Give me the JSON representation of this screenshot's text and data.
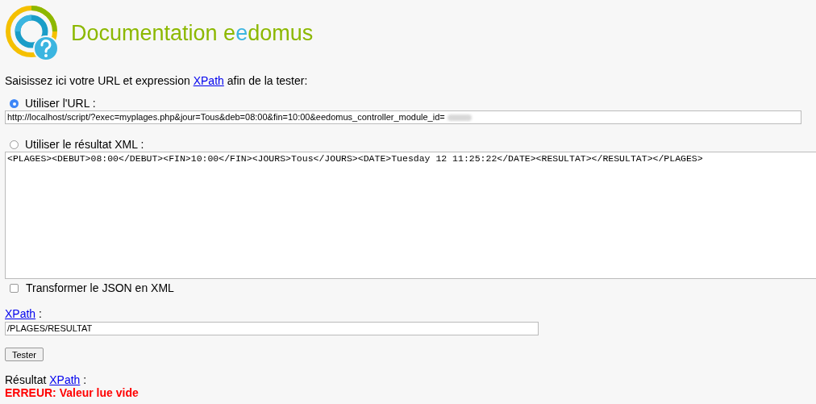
{
  "header": {
    "title": [
      {
        "text": "Documentation ",
        "color": "#8cb800"
      },
      {
        "text": "e",
        "color": "#8cb800"
      },
      {
        "text": "e",
        "color": "#3bb5e0"
      },
      {
        "text": "domus",
        "color": "#8cb800"
      }
    ]
  },
  "intro": {
    "before": "Saisissez ici votre URL et expression ",
    "link": "XPath",
    "after": " afin de la tester:"
  },
  "sources": [
    {
      "kind": "url",
      "label": "Utiliser l'URL :",
      "selected": true,
      "value": "http://localhost/script/?exec=myplages.php&jour=Tous&deb=08:00&fin=10:00&eedomus_controller_module_id=",
      "redacted": true
    },
    {
      "kind": "xml",
      "label": "Utiliser le résultat XML :",
      "selected": false,
      "value": "<PLAGES><DEBUT>08:00</DEBUT><FIN>10:00</FIN><JOURS>Tous</JOURS><DATE>Tuesday 12 11:25:22</DATE><RESULTAT></RESULTAT></PLAGES>"
    }
  ],
  "json_to_xml": {
    "label": "Transformer le JSON en XML",
    "checked": false
  },
  "xpath": {
    "link": "XPath",
    "suffix": " :",
    "value": "/PLAGES/RESULTAT"
  },
  "test_button": "Tester",
  "result": {
    "before": "Résultat ",
    "link": "XPath",
    "suffix": " :",
    "error": "ERREUR: Valeur lue vide"
  }
}
